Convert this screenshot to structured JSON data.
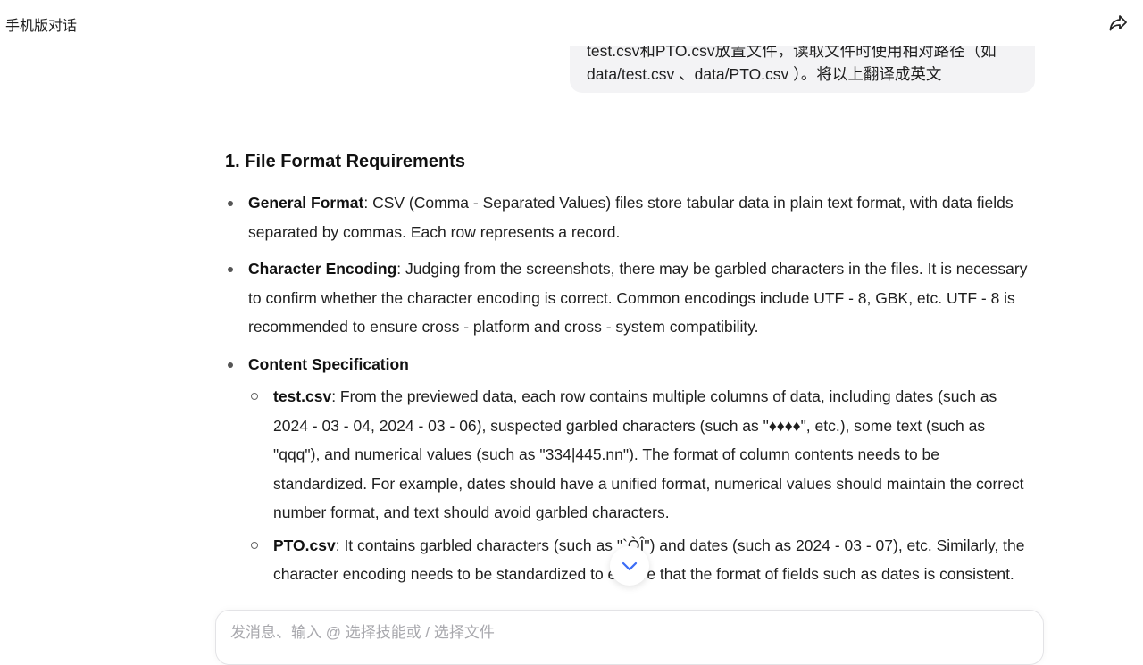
{
  "topbar": {
    "title": "手机版对话",
    "share_icon": "share-icon"
  },
  "user_message": {
    "line1": "test.csv和PTO.csv放置文件，读取文件时使用相对路径（如",
    "line2": "data/test.csv 、data/PTO.csv ）。将以上翻译成英文"
  },
  "response": {
    "heading": "1. File Format Requirements",
    "items": [
      {
        "term": "General Format",
        "text": ": CSV (Comma - Separated Values) files store tabular data in plain text format, with data fields separated by commas. Each row represents a record."
      },
      {
        "term": "Character Encoding",
        "text": ": Judging from the screenshots, there may be garbled characters in the files. It is necessary to confirm whether the character encoding is correct. Common encodings include UTF - 8, GBK, etc. UTF - 8 is recommended to ensure cross - platform and cross - system compatibility."
      },
      {
        "term": "Content Specification",
        "text": "",
        "subitems": [
          {
            "term": "test.csv",
            "text": ": From the previewed data, each row contains multiple columns of data, including dates (such as 2024 - 03 - 04, 2024 - 03 - 06), suspected garbled characters (such as \"♦♦♦♦\", etc.), some text (such as \"qqq\"), and numerical values (such as \"334|445.nn\"). The format of column contents needs to be standardized. For example, dates should have a unified format, numerical values should maintain the correct number format, and text should avoid garbled characters."
          },
          {
            "term": "PTO.csv",
            "text": ": It contains garbled characters (such as \"`ÒÎ\") and dates (such as 2024 - 03 - 07), etc. Similarly, the character encoding needs to be standardized to ensure that the format of fields such as dates is consistent."
          }
        ]
      }
    ]
  },
  "scroll_button_icon": "chevron-down-icon",
  "input": {
    "placeholder": "发消息、输入 @ 选择技能或 / 选择文件"
  }
}
